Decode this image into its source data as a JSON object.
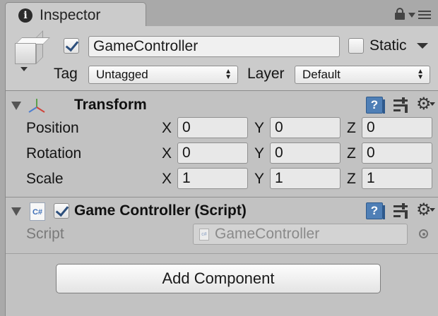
{
  "tab": {
    "title": "Inspector",
    "icon": "info-icon"
  },
  "header": {
    "active": true,
    "object_name": "GameController",
    "static_label": "Static",
    "static_checked": false,
    "tag_label": "Tag",
    "tag_value": "Untagged",
    "layer_label": "Layer",
    "layer_value": "Default"
  },
  "transform": {
    "title": "Transform",
    "rows": [
      {
        "label": "Position",
        "x": "0",
        "y": "0",
        "z": "0"
      },
      {
        "label": "Rotation",
        "x": "0",
        "y": "0",
        "z": "0"
      },
      {
        "label": "Scale",
        "x": "1",
        "y": "1",
        "z": "1"
      }
    ],
    "axis_labels": {
      "x": "X",
      "y": "Y",
      "z": "Z"
    }
  },
  "script_component": {
    "title": "Game Controller (Script)",
    "enabled": true,
    "icon_text": "C#",
    "field_label": "Script",
    "field_value": "GameController",
    "mini_icon_text": "c#"
  },
  "add_component_label": "Add Component"
}
